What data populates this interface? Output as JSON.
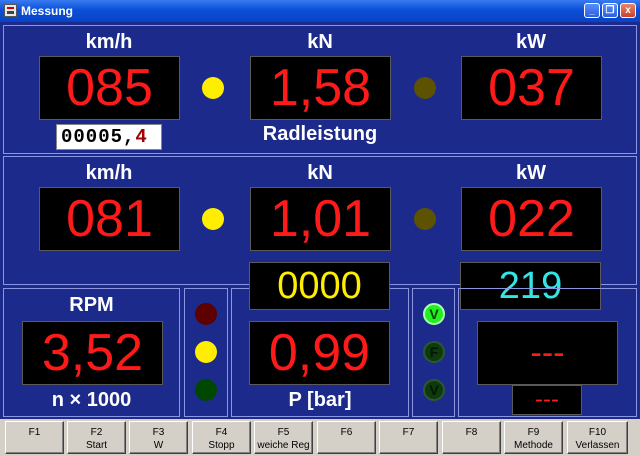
{
  "window": {
    "title": "Messung",
    "minimize": "_",
    "restore": "❐",
    "close": "x"
  },
  "row1": {
    "speed": {
      "unit": "km/h",
      "value": "085"
    },
    "force": {
      "unit": "kN",
      "value": "1,58"
    },
    "power": {
      "unit": "kW",
      "value": "037"
    },
    "odometer": {
      "int": "00005,",
      "dec": "4"
    },
    "caption": "Radleistung",
    "lamp_left": "#ffee00",
    "lamp_right": "#5c5200"
  },
  "row2": {
    "speed": {
      "unit": "km/h",
      "value": "081"
    },
    "force": {
      "unit": "kN",
      "value": "1,01"
    },
    "power": {
      "unit": "kW",
      "value": "022"
    },
    "lamp_left": "#ffee00",
    "lamp_right": "#5c5200"
  },
  "aux": {
    "yellow_value": "0000",
    "cyan_value": "219"
  },
  "rpm": {
    "label": "RPM",
    "value": "3,52",
    "unit": "n × 1000"
  },
  "traffic": {
    "red": "#5c0000",
    "yellow": "#ffee00",
    "green": "#004800"
  },
  "pressure": {
    "value": "0,99",
    "label": "P [bar]"
  },
  "status_lamps": [
    {
      "letter": "V",
      "state": "on"
    },
    {
      "letter": "F",
      "state": "off"
    },
    {
      "letter": "V",
      "state": "off"
    }
  ],
  "right_display": {
    "main": "---",
    "small": "---"
  },
  "function_keys": [
    {
      "key": "F1",
      "label": ""
    },
    {
      "key": "F2",
      "label": "Start"
    },
    {
      "key": "F3",
      "label": "W"
    },
    {
      "key": "F4",
      "label": "Stopp"
    },
    {
      "key": "F5",
      "label": "weiche Reg"
    },
    {
      "key": "F6",
      "label": ""
    },
    {
      "key": "F7",
      "label": ""
    },
    {
      "key": "F8",
      "label": ""
    },
    {
      "key": "F9",
      "label": "Methode"
    },
    {
      "key": "F10",
      "label": "Verlassen"
    }
  ]
}
